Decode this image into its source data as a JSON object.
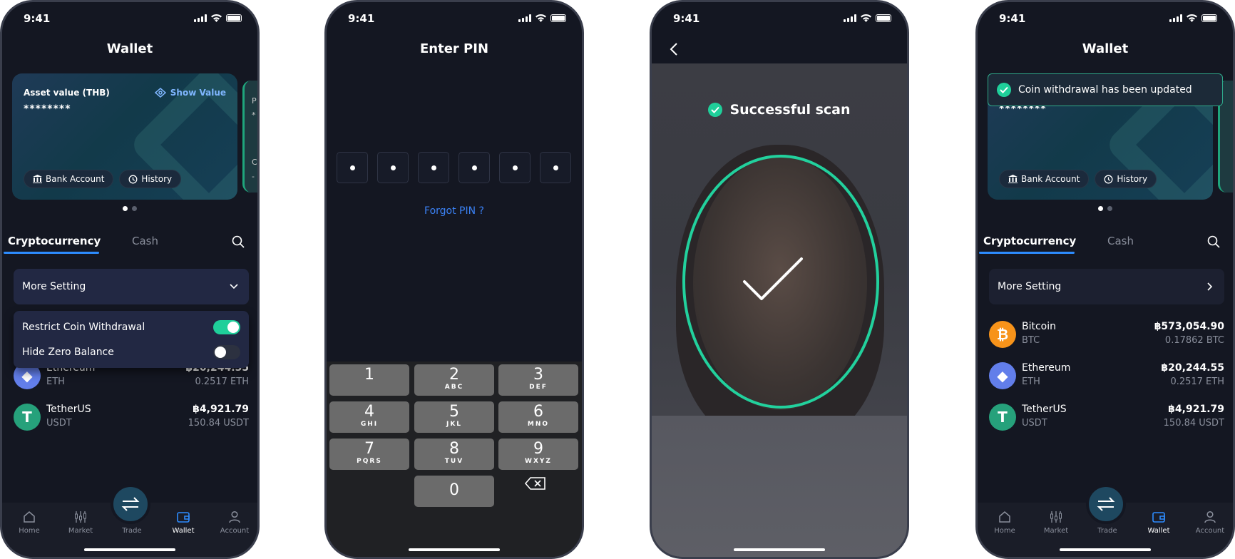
{
  "status": {
    "time": "9:41"
  },
  "screen1": {
    "title": "Wallet",
    "card": {
      "label": "Asset value (THB)",
      "show_value": "Show Value",
      "masked": "********",
      "bank": "Bank Account",
      "history": "History"
    },
    "peek": {
      "p": "P",
      "star": "*",
      "c": "C",
      "dash": "-"
    },
    "tabs": {
      "crypto": "Cryptocurrency",
      "cash": "Cash"
    },
    "more_setting": "More Setting",
    "menu": {
      "restrict": "Restrict Coin Withdrawal",
      "restrict_on": true,
      "hide_zero": "Hide Zero Balance",
      "hide_zero_on": false
    },
    "coins": [
      {
        "name": "Ethereum",
        "symbol": "ETH",
        "value": "฿20,244.55",
        "amount": "0.2517 ETH"
      },
      {
        "name": "TetherUS",
        "symbol": "USDT",
        "value": "฿4,921.79",
        "amount": "150.84 USDT"
      }
    ]
  },
  "nav": {
    "home": "Home",
    "market": "Market",
    "trade": "Trade",
    "wallet": "Wallet",
    "account": "Account"
  },
  "screen2": {
    "title": "Enter PIN",
    "forgot": "Forgot PIN ?",
    "keys": [
      {
        "d": "1",
        "l": ""
      },
      {
        "d": "2",
        "l": "ABC"
      },
      {
        "d": "3",
        "l": "DEF"
      },
      {
        "d": "4",
        "l": "GHI"
      },
      {
        "d": "5",
        "l": "JKL"
      },
      {
        "d": "6",
        "l": "MNO"
      },
      {
        "d": "7",
        "l": "PQRS"
      },
      {
        "d": "8",
        "l": "TUV"
      },
      {
        "d": "9",
        "l": "WXYZ"
      },
      {
        "d": "0",
        "l": ""
      }
    ]
  },
  "screen3": {
    "message": "Successful scan"
  },
  "screen4": {
    "title": "Wallet",
    "toast": "Coin withdrawal has been updated",
    "card": {
      "masked": "********",
      "bank": "Bank Account",
      "history": "History"
    },
    "tabs": {
      "crypto": "Cryptocurrency",
      "cash": "Cash"
    },
    "more_setting": "More Setting",
    "coins": [
      {
        "name": "Bitcoin",
        "symbol": "BTC",
        "value": "฿573,054.90",
        "amount": "0.17862 BTC"
      },
      {
        "name": "Ethereum",
        "symbol": "ETH",
        "value": "฿20,244.55",
        "amount": "0.2517 ETH"
      },
      {
        "name": "TetherUS",
        "symbol": "USDT",
        "value": "฿4,921.79",
        "amount": "150.84 USDT"
      }
    ]
  },
  "colors": {
    "accent": "#2d8cff",
    "success": "#1fcf9a",
    "bg": "#141722",
    "btc": "#f7931a",
    "eth": "#627eea",
    "usdt": "#26a17b"
  }
}
